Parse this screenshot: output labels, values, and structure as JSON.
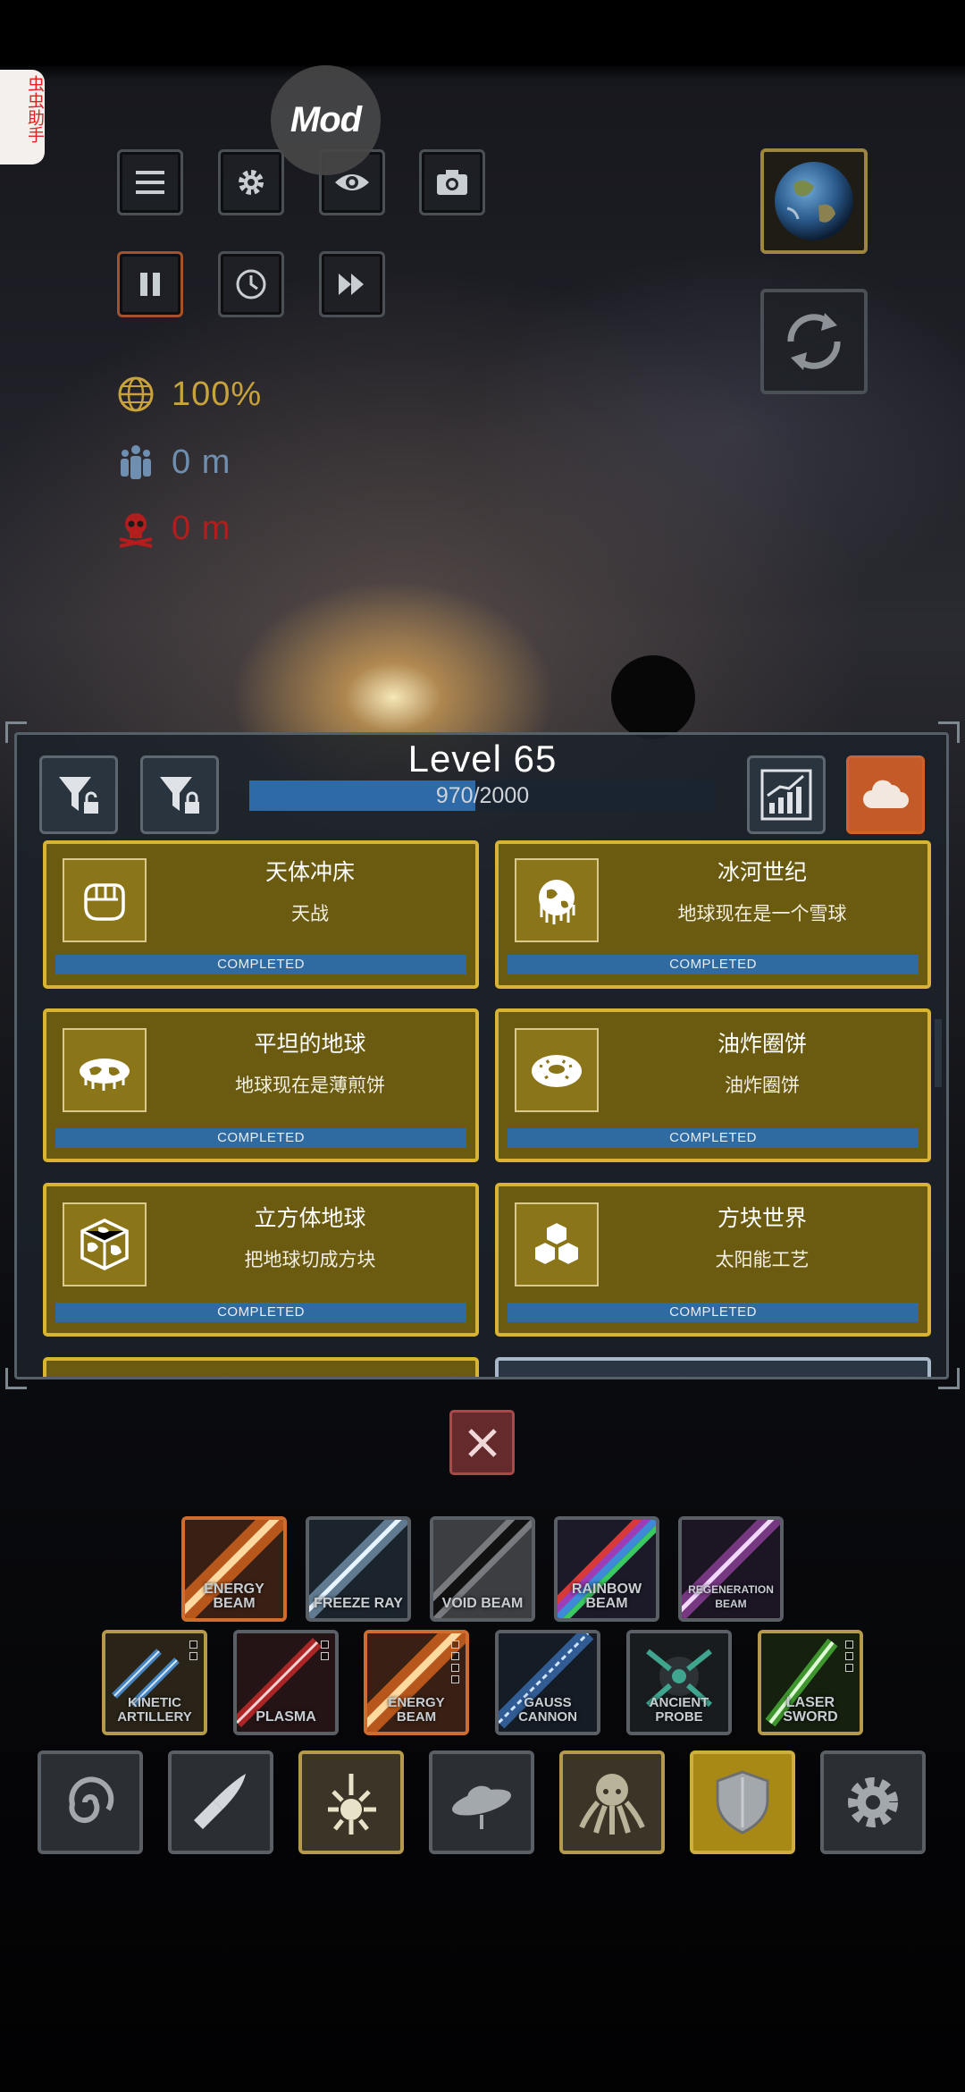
{
  "mod_badge": "Mod",
  "side_tab": "虫虫助手",
  "hud": {
    "buttons": [
      "menu-icon",
      "gear-icon",
      "eye-icon",
      "camera-icon",
      "pause-icon",
      "clock-icon",
      "fast-forward-icon"
    ],
    "planet_integrity": "100%",
    "population": "0 m",
    "deaths": "0 m",
    "colors": {
      "integrity": "#c8a33c",
      "population": "#6f8fb0",
      "deaths": "#b21e1e"
    }
  },
  "panel": {
    "level_title": "Level 65",
    "progress_text": "970/2000",
    "progress_fraction": 0.485,
    "cards": [
      {
        "title": "天体冲床",
        "desc": "天战",
        "status": "COMPLETED",
        "icon": "fist-icon"
      },
      {
        "title": "冰河世纪",
        "desc": "地球现在是一个雪球",
        "status": "COMPLETED",
        "icon": "frozen-earth-icon"
      },
      {
        "title": "平坦的地球",
        "desc": "地球现在是薄煎饼",
        "status": "COMPLETED",
        "icon": "flat-earth-icon"
      },
      {
        "title": "油炸圈饼",
        "desc": "油炸圈饼",
        "status": "COMPLETED",
        "icon": "donut-icon"
      },
      {
        "title": "立方体地球",
        "desc": "把地球切成方块",
        "status": "COMPLETED",
        "icon": "cube-earth-icon"
      },
      {
        "title": "方块世界",
        "desc": "太阳能工艺",
        "status": "COMPLETED",
        "icon": "blocks-icon"
      }
    ]
  },
  "weapons_row1": [
    {
      "label": "ENERGY BEAM",
      "color": "#d9661e"
    },
    {
      "label": "FREEZE RAY",
      "color": "#8fb6d6"
    },
    {
      "label": "VOID BEAM",
      "color": "#2a2a2a"
    },
    {
      "label": "RAINBOW BEAM",
      "color": "#9b3db8"
    },
    {
      "label": "REGENERATION BEAM",
      "color": "#b44fc0"
    }
  ],
  "weapons_row2": [
    {
      "label": "KINETIC ARTILLERY",
      "color": "#4a8fd0"
    },
    {
      "label": "PLASMA",
      "color": "#cc2a2a"
    },
    {
      "label": "ENERGY BEAM",
      "color": "#d9661e"
    },
    {
      "label": "GAUSS CANNON",
      "color": "#3c77c2"
    },
    {
      "label": "ANCIENT PROBE",
      "color": "#3fa58f"
    },
    {
      "label": "LASER SWORD",
      "color": "#52c93c"
    }
  ],
  "categories": [
    "galaxy-icon",
    "missile-icon",
    "sun-blast-icon",
    "ufo-icon",
    "octopus-icon",
    "shield-icon",
    "gear-icon"
  ]
}
